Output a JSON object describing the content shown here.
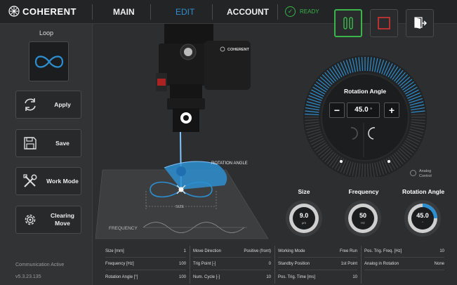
{
  "header": {
    "brand": "COHERENT",
    "nav": [
      "MAIN",
      "EDIT",
      "ACCOUNT"
    ],
    "status": "READY",
    "accent": "#2d8fd0",
    "ok_color": "#39b54a"
  },
  "sidebar": {
    "mode_title": "Loop",
    "buttons": [
      {
        "label": "Apply",
        "icon": "refresh-icon"
      },
      {
        "label": "Save",
        "icon": "floppy-disk-icon"
      },
      {
        "label": "Work Mode",
        "icon": "tools-icon"
      },
      {
        "label": "Clearing Move",
        "icon": "gear-icon"
      }
    ],
    "comm": "Communication Active",
    "version": "v5.3.23.135"
  },
  "scene": {
    "head_brand": "COHERENT",
    "rotation_label": "ROTATION ANGLE",
    "size_label": "SIZE",
    "frequency_label": "FREQUENCY"
  },
  "dial": {
    "title": "Rotation Angle",
    "value": "45.0",
    "unit": "°",
    "minus": "−",
    "plus": "+",
    "analog_label_1": "Analog",
    "analog_label_2": "Control"
  },
  "gauges": [
    {
      "title": "Size",
      "value": "9.0",
      "unit": "μm"
    },
    {
      "title": "Frequency",
      "value": "50",
      "unit": "Hz"
    },
    {
      "title": "Rotation Angle",
      "value": "45.0",
      "unit": "°"
    }
  ],
  "params": [
    [
      {
        "label": "Size [mm]",
        "value": "1"
      },
      {
        "label": "Frequency [Hz]",
        "value": "100"
      },
      {
        "label": "Rotation Angle [°]",
        "value": "100"
      }
    ],
    [
      {
        "label": "Move Direction",
        "value": "Positive (front)"
      },
      {
        "label": "Trig Point [-]",
        "value": "0"
      },
      {
        "label": "Num. Cycle [-]",
        "value": "10"
      }
    ],
    [
      {
        "label": "Working Mode",
        "value": "Free Run"
      },
      {
        "label": "Standby Position",
        "value": "1st Point"
      },
      {
        "label": "Pos. Trig. Time [ms]",
        "value": "10"
      }
    ],
    [
      {
        "label": "Pos. Trig. Freq. [Hz]",
        "value": "10"
      },
      {
        "label": "Analog in Rotation",
        "value": "None"
      },
      {
        "label": "",
        "value": ""
      }
    ]
  ]
}
